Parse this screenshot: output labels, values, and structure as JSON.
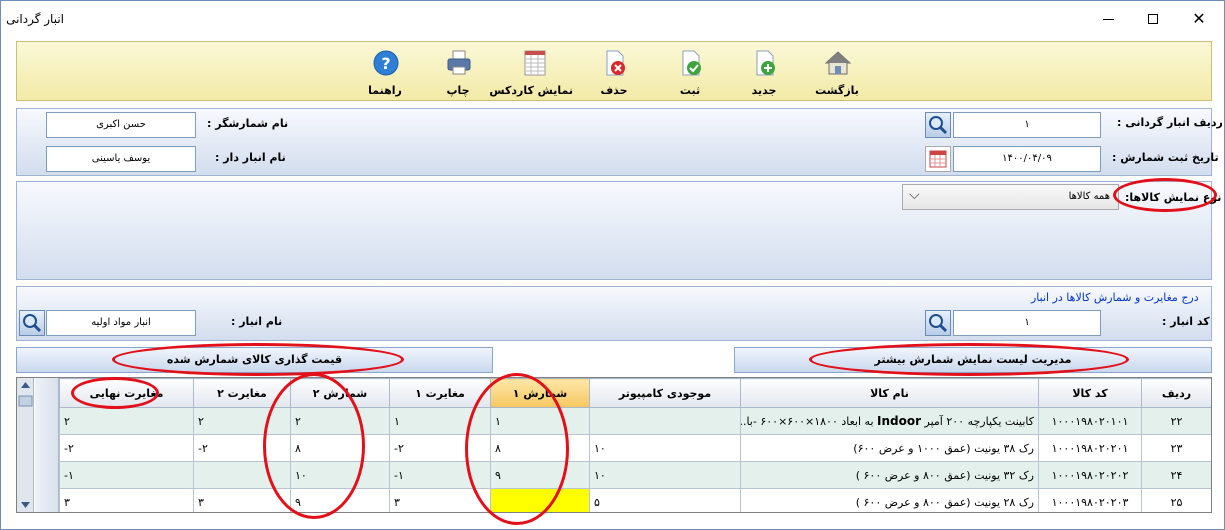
{
  "window": {
    "title": "انبار گردانی",
    "close_glyph": "✕"
  },
  "toolbar": {
    "back": "بازگشت",
    "new": "جدید",
    "save": "ثبت",
    "delete": "حذف",
    "kardex": "نمایش کاردکس",
    "print": "چاپ",
    "help": "راهنما"
  },
  "header": {
    "row_label": "ردیف انبار گردانی :",
    "row_value": "۱",
    "date_label": "تاریخ ثبت شمارش :",
    "date_value": "۱۴۰۰/۰۴/۰۹",
    "counter_label": "نام شمارشگر :",
    "counter_value": "حسن اکبری",
    "keeper_label": "نام انبار دار :",
    "keeper_value": "یوسف یاسینی"
  },
  "filter": {
    "label": "نوع نمایش کالاها:",
    "selected": "همه کالاها",
    "chevron": "⌵"
  },
  "warehouse": {
    "section_title": "درج مغایرت و شمارش کالاها در انبار",
    "code_label": "کد انبار :",
    "code_value": "۱",
    "name_label": "نام انبار :",
    "name_value": "انبار مواد اولیه"
  },
  "actions": {
    "manage_list": "مدیریت لیست نمایش شمارش بیشتر",
    "pricing": "قیمت گذاری کالای شمارش شده"
  },
  "table": {
    "headers": [
      "ردیف",
      "کد کالا",
      "نام کالا",
      "موجودی کامپیوتر",
      "شمارش ۱",
      "مغایرت ۱",
      "شمارش ۲",
      "مغایرت ۲",
      "مغایرت نهایی"
    ],
    "rows": [
      {
        "row": "۲۲",
        "code": "۱۰۰۰۱۹۸۰۲۰۱۰۱",
        "name_pre": "کابینت یکپارچه ۲۰۰ آمپر ",
        "name_bold": "Indoor",
        "name_post": " به ابعاد ۱۸۰۰×۶۰۰×۶۰۰ -با...",
        "stock": "",
        "c1": "۱",
        "d1": "۱",
        "c2": "۲",
        "d2": "۲",
        "final": "۲"
      },
      {
        "row": "۲۳",
        "code": "۱۰۰۰۱۹۸۰۲۰۲۰۱",
        "name_pre": "رک ۳۸ یونیت (عمق ۱۰۰۰ و عرض ۶۰۰)",
        "name_bold": "",
        "name_post": "",
        "stock": "۱۰",
        "c1": "۸",
        "d1": "-۲",
        "c2": "۸",
        "d2": "-۲",
        "final": "-۲"
      },
      {
        "row": "۲۴",
        "code": "۱۰۰۰۱۹۸۰۲۰۲۰۲",
        "name_pre": "رک ۳۲ یونیت (عمق ۸۰۰ و عرض ۶۰۰ )",
        "name_bold": "",
        "name_post": "",
        "stock": "۱۰",
        "c1": "۹",
        "d1": "-۱",
        "c2": "۱۰",
        "d2": "",
        "final": "-۱"
      },
      {
        "row": "۲۵",
        "code": "۱۰۰۰۱۹۸۰۲۰۲۰۳",
        "name_pre": "رک ۲۸ یونیت (عمق ۸۰۰ و عرض ۶۰۰ )",
        "name_bold": "",
        "name_post": "",
        "stock": "۵",
        "c1": "",
        "d1": "۳",
        "c2": "۹",
        "d2": "۳",
        "final": "۳"
      }
    ]
  },
  "colors": {
    "annotation": "#e3101a",
    "highlight": "#ffff00",
    "toolbar": "#f2eaa6"
  }
}
